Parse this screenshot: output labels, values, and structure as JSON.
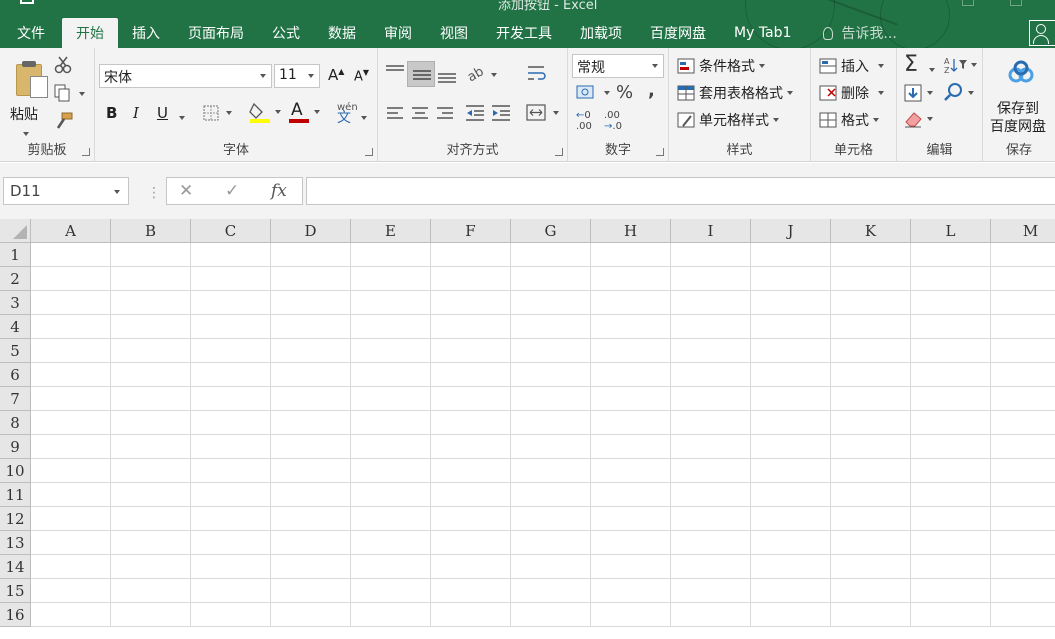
{
  "app": {
    "title": "添加按钮 - Excel"
  },
  "tabs": [
    {
      "label": "文件",
      "key": "file"
    },
    {
      "label": "开始",
      "key": "home",
      "active": true
    },
    {
      "label": "插入",
      "key": "insert"
    },
    {
      "label": "页面布局",
      "key": "page-layout"
    },
    {
      "label": "公式",
      "key": "formulas"
    },
    {
      "label": "数据",
      "key": "data"
    },
    {
      "label": "审阅",
      "key": "review"
    },
    {
      "label": "视图",
      "key": "view"
    },
    {
      "label": "开发工具",
      "key": "developer"
    },
    {
      "label": "加载项",
      "key": "addins"
    },
    {
      "label": "百度网盘",
      "key": "baidu"
    },
    {
      "label": "My Tab1",
      "key": "mytab1"
    }
  ],
  "tell_me": {
    "placeholder": "告诉我..."
  },
  "ribbon": {
    "clipboard": {
      "label": "剪贴板",
      "paste": "粘贴"
    },
    "font": {
      "label": "字体",
      "font_name": "宋体",
      "font_size": "11",
      "bold": "B",
      "italic": "I",
      "underline": "U",
      "grow": "A",
      "shrink": "A",
      "phonetic": "wén",
      "font_color_glyph": "A"
    },
    "alignment": {
      "label": "对齐方式"
    },
    "number": {
      "label": "数字",
      "format": "常规",
      "percent": "%",
      "comma": ",",
      "inc_decimal": ".00",
      "dec_decimal": ".0"
    },
    "styles": {
      "label": "样式",
      "conditional": "条件格式",
      "table": "套用表格格式",
      "cell_styles": "单元格样式"
    },
    "cells": {
      "label": "单元格",
      "insert": "插入",
      "delete": "删除",
      "format": "格式"
    },
    "editing": {
      "label": "编辑",
      "sum": "Σ"
    },
    "save": {
      "label": "保存",
      "button_line1": "保存到",
      "button_line2": "百度网盘"
    }
  },
  "formula_bar": {
    "name_box": "D11",
    "cancel": "✕",
    "enter": "✓",
    "fx": "fx",
    "value": ""
  },
  "sheet": {
    "columns": [
      "A",
      "B",
      "C",
      "D",
      "E",
      "F",
      "G",
      "H",
      "I",
      "J",
      "K",
      "L",
      "M"
    ],
    "rows": [
      "1",
      "2",
      "3",
      "4",
      "5",
      "6",
      "7",
      "8",
      "9",
      "10",
      "11",
      "12",
      "13",
      "14",
      "15",
      "16"
    ]
  }
}
